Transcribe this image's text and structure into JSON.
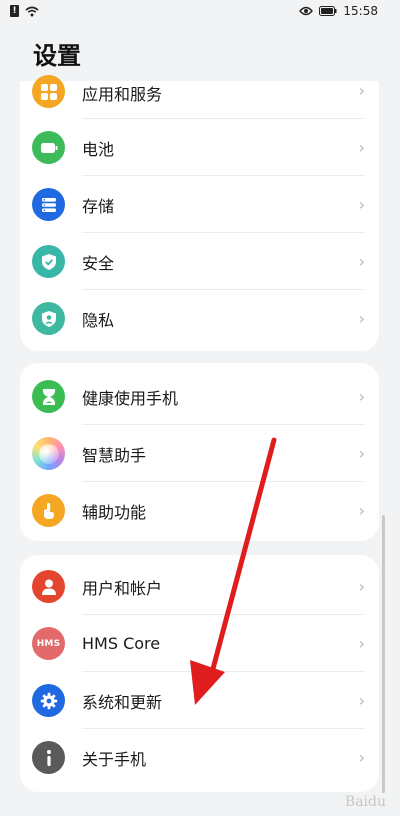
{
  "status": {
    "time": "15:58"
  },
  "title": "设置",
  "groups": [
    {
      "items": [
        {
          "label": "应用和服务",
          "icon": "apps-icon",
          "color": "#f5a623"
        },
        {
          "label": "电池",
          "icon": "battery-icon",
          "color": "#3dbb5a"
        },
        {
          "label": "存储",
          "icon": "storage-icon",
          "color": "#1f6ae0"
        },
        {
          "label": "安全",
          "icon": "shield-icon",
          "color": "#38b6a8"
        },
        {
          "label": "隐私",
          "icon": "privacy-icon",
          "color": "#3fb8a1"
        }
      ]
    },
    {
      "items": [
        {
          "label": "健康使用手机",
          "icon": "hourglass-icon",
          "color": "#3cbd54"
        },
        {
          "label": "智慧助手",
          "icon": "assistant-icon",
          "color": "#b784e8"
        },
        {
          "label": "辅助功能",
          "icon": "hand-icon",
          "color": "#f5a623"
        }
      ]
    },
    {
      "items": [
        {
          "label": "用户和帐户",
          "icon": "user-icon",
          "color": "#e4452f"
        },
        {
          "label": "HMS Core",
          "icon": "hms-icon",
          "icon_text": "HMS",
          "color": "#e36a6a"
        },
        {
          "label": "系统和更新",
          "icon": "gear-icon",
          "color": "#1f6ae0"
        },
        {
          "label": "关于手机",
          "icon": "info-icon",
          "color": "#5a5a5a"
        }
      ]
    }
  ],
  "annotation": {
    "arrow_color": "#e01d1d"
  }
}
